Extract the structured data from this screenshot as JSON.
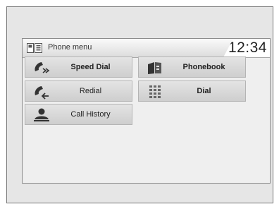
{
  "header": {
    "title": "Phone menu",
    "time": "12:34",
    "icon": "phone-menu-icon"
  },
  "menu": {
    "speed_dial": {
      "label": "Speed Dial",
      "icon": "speed-dial-handset-icon"
    },
    "redial": {
      "label": "Redial",
      "icon": "redial-handset-icon"
    },
    "call_history": {
      "label": "Call History",
      "icon": "call-history-person-icon"
    },
    "phonebook": {
      "label": "Phonebook",
      "icon": "phonebook-icon"
    },
    "dial": {
      "label": "Dial",
      "icon": "dial-keypad-icon"
    }
  }
}
